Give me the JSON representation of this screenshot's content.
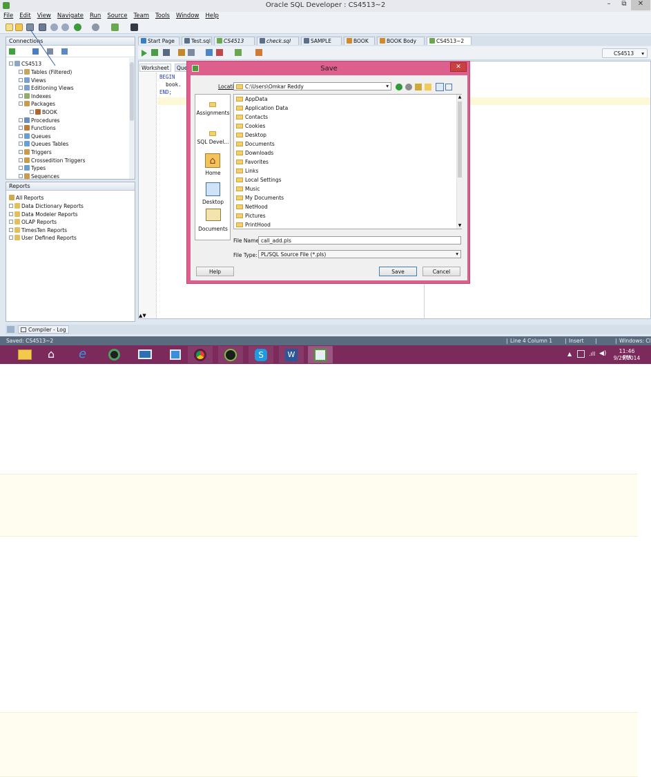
{
  "window": {
    "title": "Oracle SQL Developer : CS4513~2",
    "minimize": "–",
    "restore": "⧉",
    "close": "✕"
  },
  "menu": [
    "File",
    "Edit",
    "View",
    "Navigate",
    "Run",
    "Source",
    "Team",
    "Tools",
    "Window",
    "Help"
  ],
  "connections": {
    "header": "Connections",
    "root": "CS4513",
    "items": [
      "Tables (Filtered)",
      "Views",
      "Editioning Views",
      "Indexes",
      "Packages",
      "BOOK",
      "Procedures",
      "Functions",
      "Queues",
      "Queues Tables",
      "Triggers",
      "Crossedition Triggers",
      "Types",
      "Sequences"
    ]
  },
  "reports": {
    "header": "Reports",
    "root": "All Reports",
    "items": [
      "Data Dictionary Reports",
      "Data Modeler Reports",
      "OLAP Reports",
      "TimesTen Reports",
      "User Defined Reports"
    ]
  },
  "editor": {
    "tabs": [
      "Start Page",
      "Test.sql",
      "CS4513",
      "check.sql",
      "SAMPLE",
      "BOOK",
      "BOOK Body",
      "CS4513~2"
    ],
    "subtabs": [
      "Worksheet",
      "Que"
    ],
    "connection_selector": "CS4513",
    "code": [
      "BEGIN",
      "  book.",
      "END;"
    ]
  },
  "dialog": {
    "title": "Save",
    "location_label": "Location:",
    "location_value": "C:\\Users\\Omkar Reddy",
    "places": [
      "Assignments",
      "SQL Devel...",
      "Home",
      "Desktop",
      "Documents"
    ],
    "files": [
      "AppData",
      "Application Data",
      "Contacts",
      "Cookies",
      "Desktop",
      "Documents",
      "Downloads",
      "Favorites",
      "Links",
      "Local Settings",
      "Music",
      "My Documents",
      "NetHood",
      "Pictures",
      "PrintHood"
    ],
    "file_name_label": "File Name:",
    "file_name_value": "call_add.pls",
    "file_type_label": "File Type:",
    "file_type_value": "PL/SQL Source File (*.pls)",
    "help": "Help",
    "save": "Save",
    "cancel": "Cancel"
  },
  "bottom": {
    "log_tab": "Compiler - Log"
  },
  "status": {
    "left": "Saved: CS4513~2",
    "line": "Line 4 Column 1",
    "mode": "Insert",
    "platform": "Windows: Cl"
  },
  "clock": {
    "time": "11:46 PM",
    "date": "9/29/2014"
  }
}
